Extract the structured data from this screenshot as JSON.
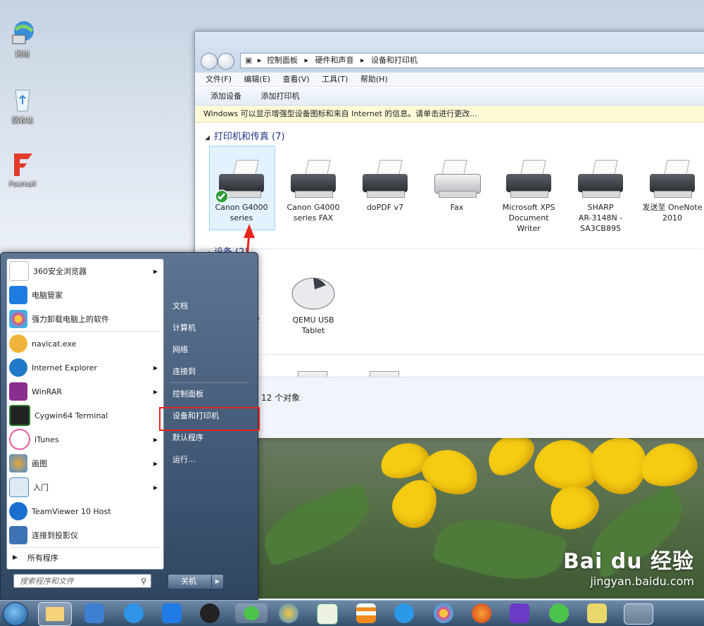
{
  "desktop": {
    "icons": [
      {
        "label": "网络",
        "icon": "network-icon"
      },
      {
        "label": "回收站",
        "icon": "recycle-bin-icon"
      },
      {
        "label": "Foxmail",
        "icon": "foxmail-icon"
      }
    ]
  },
  "explorer": {
    "breadcrumb": [
      "控制面板",
      "硬件和声音",
      "设备和打印机"
    ],
    "menu": [
      "文件(F)",
      "编辑(E)",
      "查看(V)",
      "工具(T)",
      "帮助(H)"
    ],
    "toolbar": [
      "添加设备",
      "添加打印机"
    ],
    "infobar": "Windows 可以显示增强型设备图标和来自 Internet 的信息。请单击进行更改...",
    "printers_group": "打印机和传真 (7)",
    "printers": [
      {
        "name": "Canon G4000 series",
        "line1": "Canon G4000",
        "line2": "series",
        "line3": ""
      },
      {
        "name": "Canon G4000 series FAX",
        "line1": "Canon G4000",
        "line2": "series FAX",
        "line3": ""
      },
      {
        "name": "doPDF v7",
        "line1": "doPDF v7",
        "line2": "",
        "line3": ""
      },
      {
        "name": "Fax",
        "line1": "Fax",
        "line2": "",
        "line3": ""
      },
      {
        "name": "Microsoft XPS Document Writer",
        "line1": "Microsoft XPS",
        "line2": "Document",
        "line3": "Writer"
      },
      {
        "name": "SHARP AR-3148N - SA3CB895",
        "line1": "SHARP",
        "line2": "AR-3148N -",
        "line3": "SA3CB895"
      },
      {
        "name": "发送至 OneNote 2010",
        "line1": "发送至 OneNote",
        "line2": "2010",
        "line3": ""
      }
    ],
    "devices_group": "设备 (2)",
    "devices": [
      {
        "line1": "22",
        "line2": ""
      },
      {
        "line1": "QEMU USB",
        "line2": "Tablet"
      }
    ],
    "status": "12 个对象"
  },
  "start_menu": {
    "programs": [
      {
        "label": "360安全浏览器",
        "arrow": true,
        "color": "#ffffff"
      },
      {
        "label": "电脑管家",
        "arrow": false,
        "color": "#1e7be0"
      },
      {
        "label": "强力卸载电脑上的软件",
        "arrow": false,
        "color": "#e94b8a"
      },
      {
        "label": "navicat.exe",
        "arrow": false,
        "color": "#f0b43c"
      },
      {
        "label": "Internet Explorer",
        "arrow": true,
        "color": "#1f78c8"
      },
      {
        "label": "WinRAR",
        "arrow": true,
        "color": "#8b2c8f"
      },
      {
        "label": "Cygwin64 Terminal",
        "arrow": false,
        "color": "#2e7d32"
      },
      {
        "label": "iTunes",
        "arrow": true,
        "color": "#e85b9c"
      },
      {
        "label": "画图",
        "arrow": true,
        "color": "#e9a53a"
      },
      {
        "label": "入门",
        "arrow": true,
        "color": "#4b8fd1"
      },
      {
        "label": "TeamViewer 10 Host",
        "arrow": false,
        "color": "#1b6fd0"
      },
      {
        "label": "连接到投影仪",
        "arrow": false,
        "color": "#3d73b5"
      }
    ],
    "all_programs": "所有程序",
    "search_placeholder": "搜索程序和文件",
    "right_items": [
      "文档",
      "计算机",
      "网络",
      "连接到",
      "控制面板",
      "设备和打印机",
      "默认程序",
      "运行..."
    ],
    "shutdown": "关机"
  },
  "watermark": {
    "brand": "Bai du 经验",
    "url": "jingyan.baidu.com"
  }
}
